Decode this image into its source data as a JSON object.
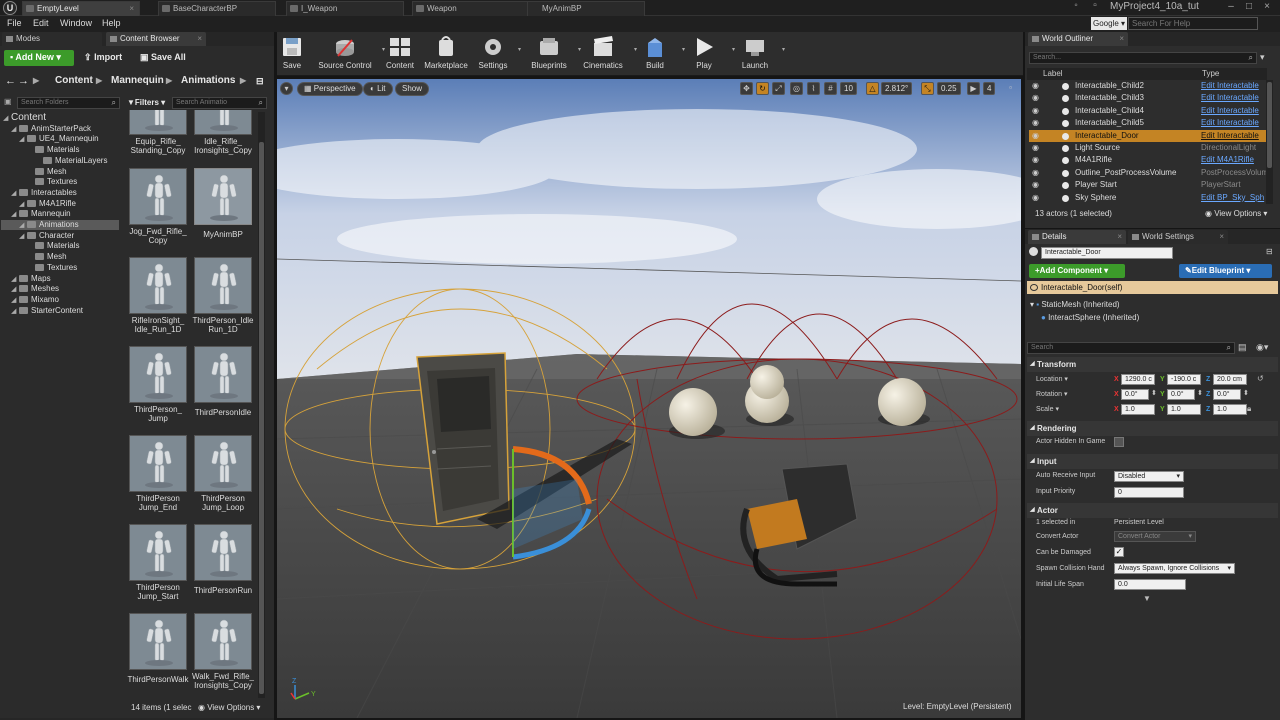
{
  "tabs": [
    {
      "label": "EmptyLevel",
      "active": true
    },
    {
      "label": "BaseCharacterBP"
    },
    {
      "label": "I_Weapon"
    },
    {
      "label": "Weapon"
    },
    {
      "label": "MyAnimBP"
    }
  ],
  "project_title": "MyProject4_10a_tut",
  "menu": [
    "File",
    "Edit",
    "Window",
    "Help"
  ],
  "help_search": {
    "provider": "Google",
    "placeholder": "Search For Help"
  },
  "left_tabs": {
    "modes": "Modes",
    "content_browser": "Content Browser"
  },
  "cb_toolbar": {
    "add_new": "Add New",
    "import": "Import",
    "save_all": "Save All"
  },
  "breadcrumb": [
    "Content",
    "Mannequin",
    "Animations"
  ],
  "search_folders_placeholder": "Search Folders",
  "filters_label": "Filters",
  "search_anim_placeholder": "Search Animatio",
  "folder_tree": [
    {
      "label": "Content",
      "depth": 0,
      "root": true
    },
    {
      "label": "AnimStarterPack",
      "depth": 1
    },
    {
      "label": "UE4_Mannequin",
      "depth": 2
    },
    {
      "label": "Materials",
      "depth": 3
    },
    {
      "label": "MaterialLayers",
      "depth": 4
    },
    {
      "label": "Mesh",
      "depth": 3
    },
    {
      "label": "Textures",
      "depth": 3
    },
    {
      "label": "Interactables",
      "depth": 1
    },
    {
      "label": "M4A1Rifle",
      "depth": 2
    },
    {
      "label": "Mannequin",
      "depth": 1
    },
    {
      "label": "Animations",
      "depth": 2,
      "selected": true
    },
    {
      "label": "Character",
      "depth": 2
    },
    {
      "label": "Materials",
      "depth": 3
    },
    {
      "label": "Mesh",
      "depth": 3
    },
    {
      "label": "Textures",
      "depth": 3
    },
    {
      "label": "Maps",
      "depth": 1
    },
    {
      "label": "Meshes",
      "depth": 1
    },
    {
      "label": "Mixamo",
      "depth": 1
    },
    {
      "label": "StarterContent",
      "depth": 1
    }
  ],
  "assets": [
    {
      "label": "Equip_Rifle_\nStanding_Copy"
    },
    {
      "label": "Idle_Rifle_\nIronsights_Copy"
    },
    {
      "label": "Jog_Fwd_Rifle_\nCopy"
    },
    {
      "label": "MyAnimBP",
      "selected": true
    },
    {
      "label": "RifleIronSight_\nIdle_Run_1D"
    },
    {
      "label": "ThirdPerson_Idle\nRun_1D"
    },
    {
      "label": "ThirdPerson_\nJump"
    },
    {
      "label": "ThirdPersonIdle"
    },
    {
      "label": "ThirdPerson\nJump_End"
    },
    {
      "label": "ThirdPerson\nJump_Loop"
    },
    {
      "label": "ThirdPerson\nJump_Start"
    },
    {
      "label": "ThirdPersonRun"
    },
    {
      "label": "ThirdPersonWalk"
    },
    {
      "label": "Walk_Fwd_Rifle_\nIronsights_Copy"
    }
  ],
  "items_count": "14 items (1 selec",
  "view_options": "View Options",
  "toolbar": [
    {
      "label": "Save",
      "icon": "save-icon",
      "drop": false
    },
    {
      "label": "Source Control",
      "icon": "source-control-icon",
      "drop": true
    },
    {
      "label": "Content",
      "icon": "content-icon",
      "drop": false
    },
    {
      "label": "Marketplace",
      "icon": "marketplace-icon",
      "drop": false
    },
    {
      "label": "Settings",
      "icon": "settings-icon",
      "drop": true
    },
    {
      "label": "Blueprints",
      "icon": "blueprints-icon",
      "drop": true
    },
    {
      "label": "Cinematics",
      "icon": "cinematics-icon",
      "drop": true
    },
    {
      "label": "Build",
      "icon": "build-icon",
      "drop": true
    },
    {
      "label": "Play",
      "icon": "play-icon",
      "drop": true
    },
    {
      "label": "Launch",
      "icon": "launch-icon",
      "drop": true
    }
  ],
  "viewport": {
    "perspective": "Perspective",
    "lit": "Lit",
    "show": "Show",
    "grid_snap": "10",
    "rot_snap": "2.812°",
    "scale_snap": "0.25",
    "cam_speed": "4",
    "level_label": "Level:",
    "level_name": "EmptyLevel (Persistent)"
  },
  "outliner": {
    "tab": "World Outliner",
    "search_placeholder": "Search...",
    "col_label": "Label",
    "col_type": "Type",
    "rows": [
      {
        "label": "Interactable_Child2",
        "type": "Edit Interactable",
        "link": true
      },
      {
        "label": "Interactable_Child3",
        "type": "Edit Interactable",
        "link": true
      },
      {
        "label": "Interactable_Child4",
        "type": "Edit Interactable",
        "link": true
      },
      {
        "label": "Interactable_Child5",
        "type": "Edit Interactable",
        "link": true
      },
      {
        "label": "Interactable_Door",
        "type": "Edit Interactable",
        "link": true,
        "selected": true
      },
      {
        "label": "Light Source",
        "type": "DirectionalLight",
        "link": false
      },
      {
        "label": "M4A1Rifle",
        "type": "Edit M4A1Rifle",
        "link": true
      },
      {
        "label": "Outline_PostProcessVolume",
        "type": "PostProcessVolume",
        "link": false
      },
      {
        "label": "Player Start",
        "type": "PlayerStart",
        "link": false
      },
      {
        "label": "Sky Sphere",
        "type": "Edit BP_Sky_Sph",
        "link": true
      }
    ],
    "summary": "13 actors (1 selected)",
    "view_options": "View Options"
  },
  "details": {
    "tab_details": "Details",
    "tab_world": "World Settings",
    "actor_name": "Interactable_Door",
    "add_component": "Add Component",
    "edit_blueprint": "Edit Blueprint",
    "self_row": "Interactable_Door(self)",
    "components": [
      "StaticMesh (Inherited)",
      "InteractSphere (Inherited)"
    ],
    "search_placeholder": "Search",
    "transform": "Transform",
    "location_label": "Location",
    "location": [
      "1290.0 c",
      "-190.0 c",
      "20.0 cm"
    ],
    "rotation_label": "Rotation",
    "rotation": [
      "0.0°",
      "0.0°",
      "0.0°"
    ],
    "scale_label": "Scale",
    "scale": [
      "1.0",
      "1.0",
      "1.0"
    ],
    "rendering": "Rendering",
    "actor_hidden": "Actor Hidden In Game",
    "input": "Input",
    "auto_receive_label": "Auto Receive Input",
    "auto_receive_value": "Disabled",
    "input_priority_label": "Input Priority",
    "input_priority_value": "0",
    "actor": "Actor",
    "selected_in_label": "1 selected in",
    "selected_in_value": "Persistent Level",
    "convert_label": "Convert Actor",
    "convert_value": "Convert Actor",
    "can_be_damaged": "Can be Damaged",
    "spawn_label": "Spawn Collision Hand",
    "spawn_value": "Always Spawn, Ignore Collisions",
    "life_span_label": "Initial Life Span",
    "life_span_value": "0.0"
  },
  "colors": {
    "accent": "#c48424",
    "green": "#3c9b2a",
    "blue_btn": "#2a6db5",
    "link": "#6aa8ff"
  }
}
